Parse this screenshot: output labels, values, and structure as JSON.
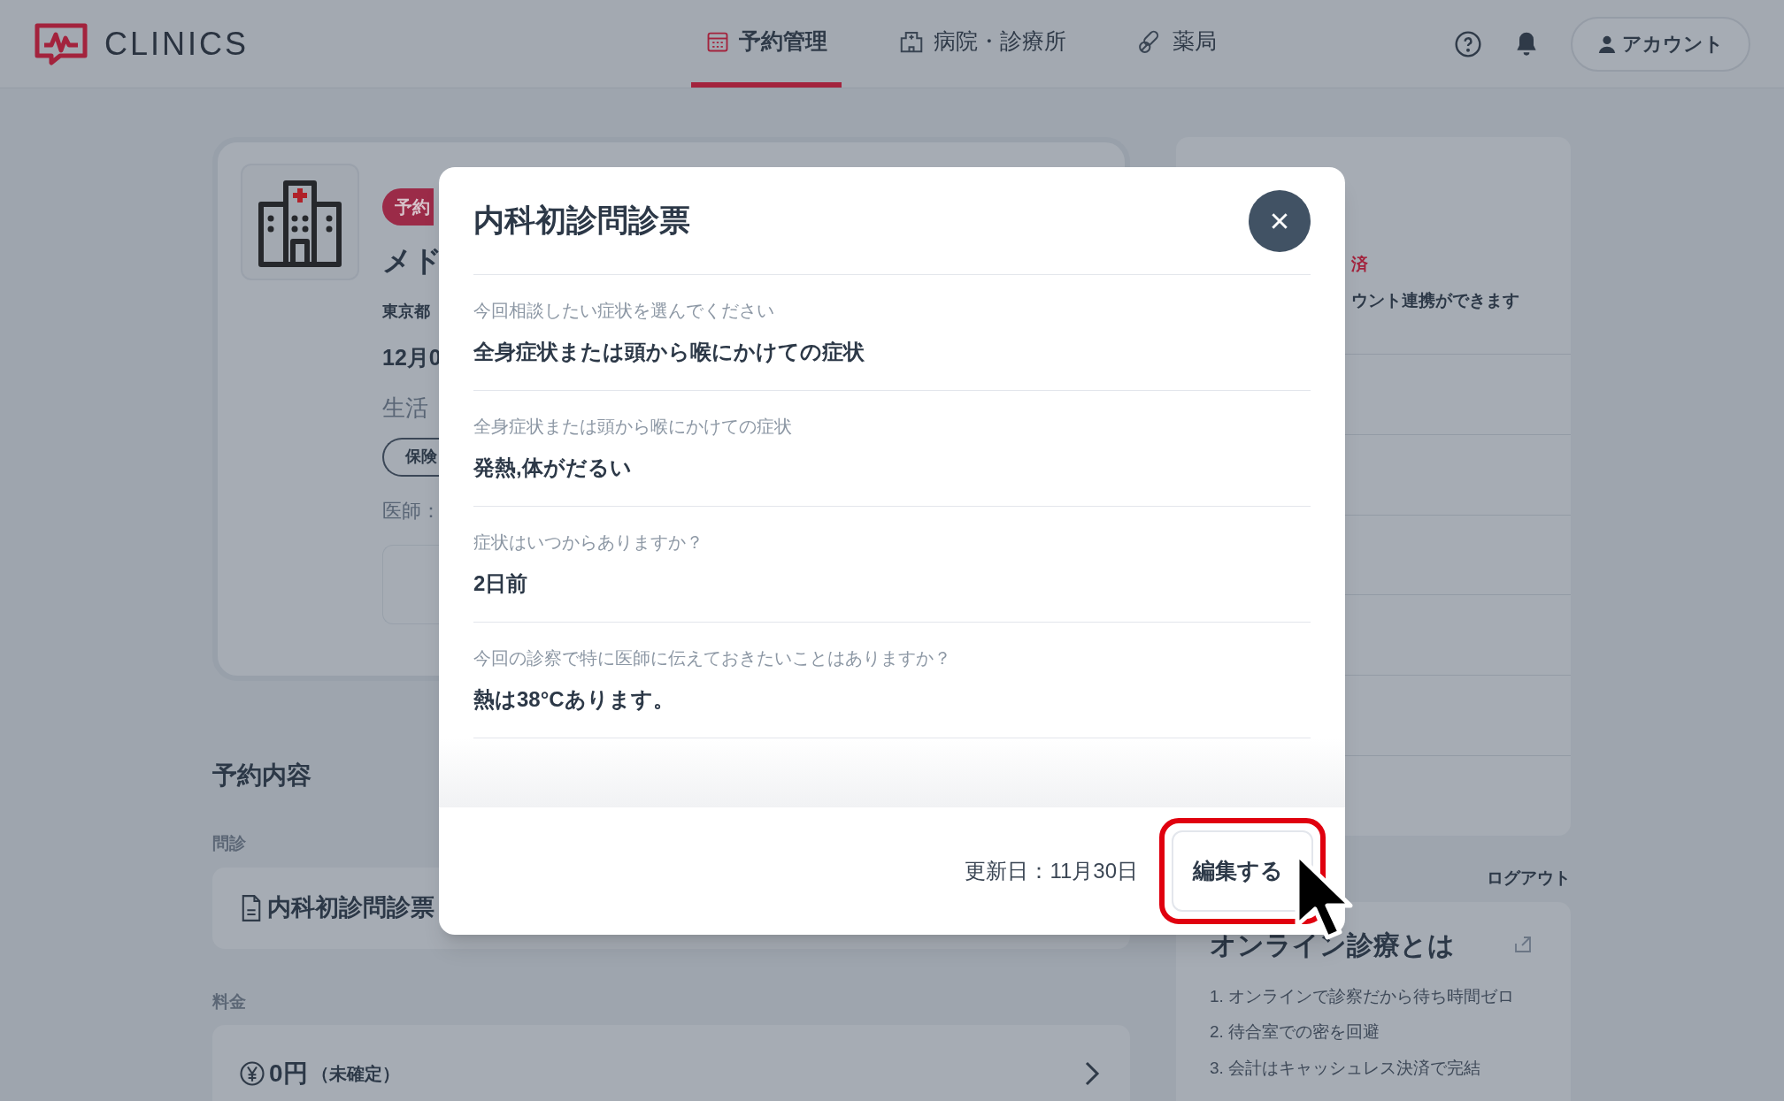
{
  "header": {
    "logo": "CLINICS",
    "nav": [
      {
        "label": "予約管理",
        "kind": "calendar",
        "selected": true
      },
      {
        "label": "病院・診療所",
        "kind": "hospital",
        "selected": false
      },
      {
        "label": "薬局",
        "kind": "pills",
        "selected": false
      }
    ],
    "account": "アカウント"
  },
  "reservation_card": {
    "badge": "予約",
    "name": "メド",
    "address": "東京都",
    "date": "12月0",
    "category": "生活",
    "tag": "保険",
    "doctor": "医師："
  },
  "section_title": "予約内容",
  "questionnaire": {
    "label": "問診",
    "title": "内科初診問診票"
  },
  "fee": {
    "label": "料金",
    "amount": "0円",
    "note": "（未確定）"
  },
  "side_panel": {
    "status": "済",
    "note": "ウント連携ができます"
  },
  "logout": "ログアウト",
  "online_info": {
    "title": "オンライン診療とは",
    "items": [
      "1. オンラインで診察だから待ち時間ゼロ",
      "2. 待合室での密を回避",
      "3. 会計はキャッシュレス決済で完結"
    ]
  },
  "modal": {
    "title": "内科初診問診票",
    "items": [
      {
        "question": "今回相談したい症状を選んでください",
        "answer": "全身症状または頭から喉にかけての症状"
      },
      {
        "question": "全身症状または頭から喉にかけての症状",
        "answer": "発熱,体がだるい"
      },
      {
        "question": "症状はいつからありますか？",
        "answer": "2日前"
      },
      {
        "question": "今回の診察で特に医師に伝えておきたいことはありますか？",
        "answer": "熱は38°Cあります。"
      }
    ],
    "updated": "更新日：11月30日",
    "edit_button": {
      "label": "編集する",
      "highlighted": true
    }
  }
}
